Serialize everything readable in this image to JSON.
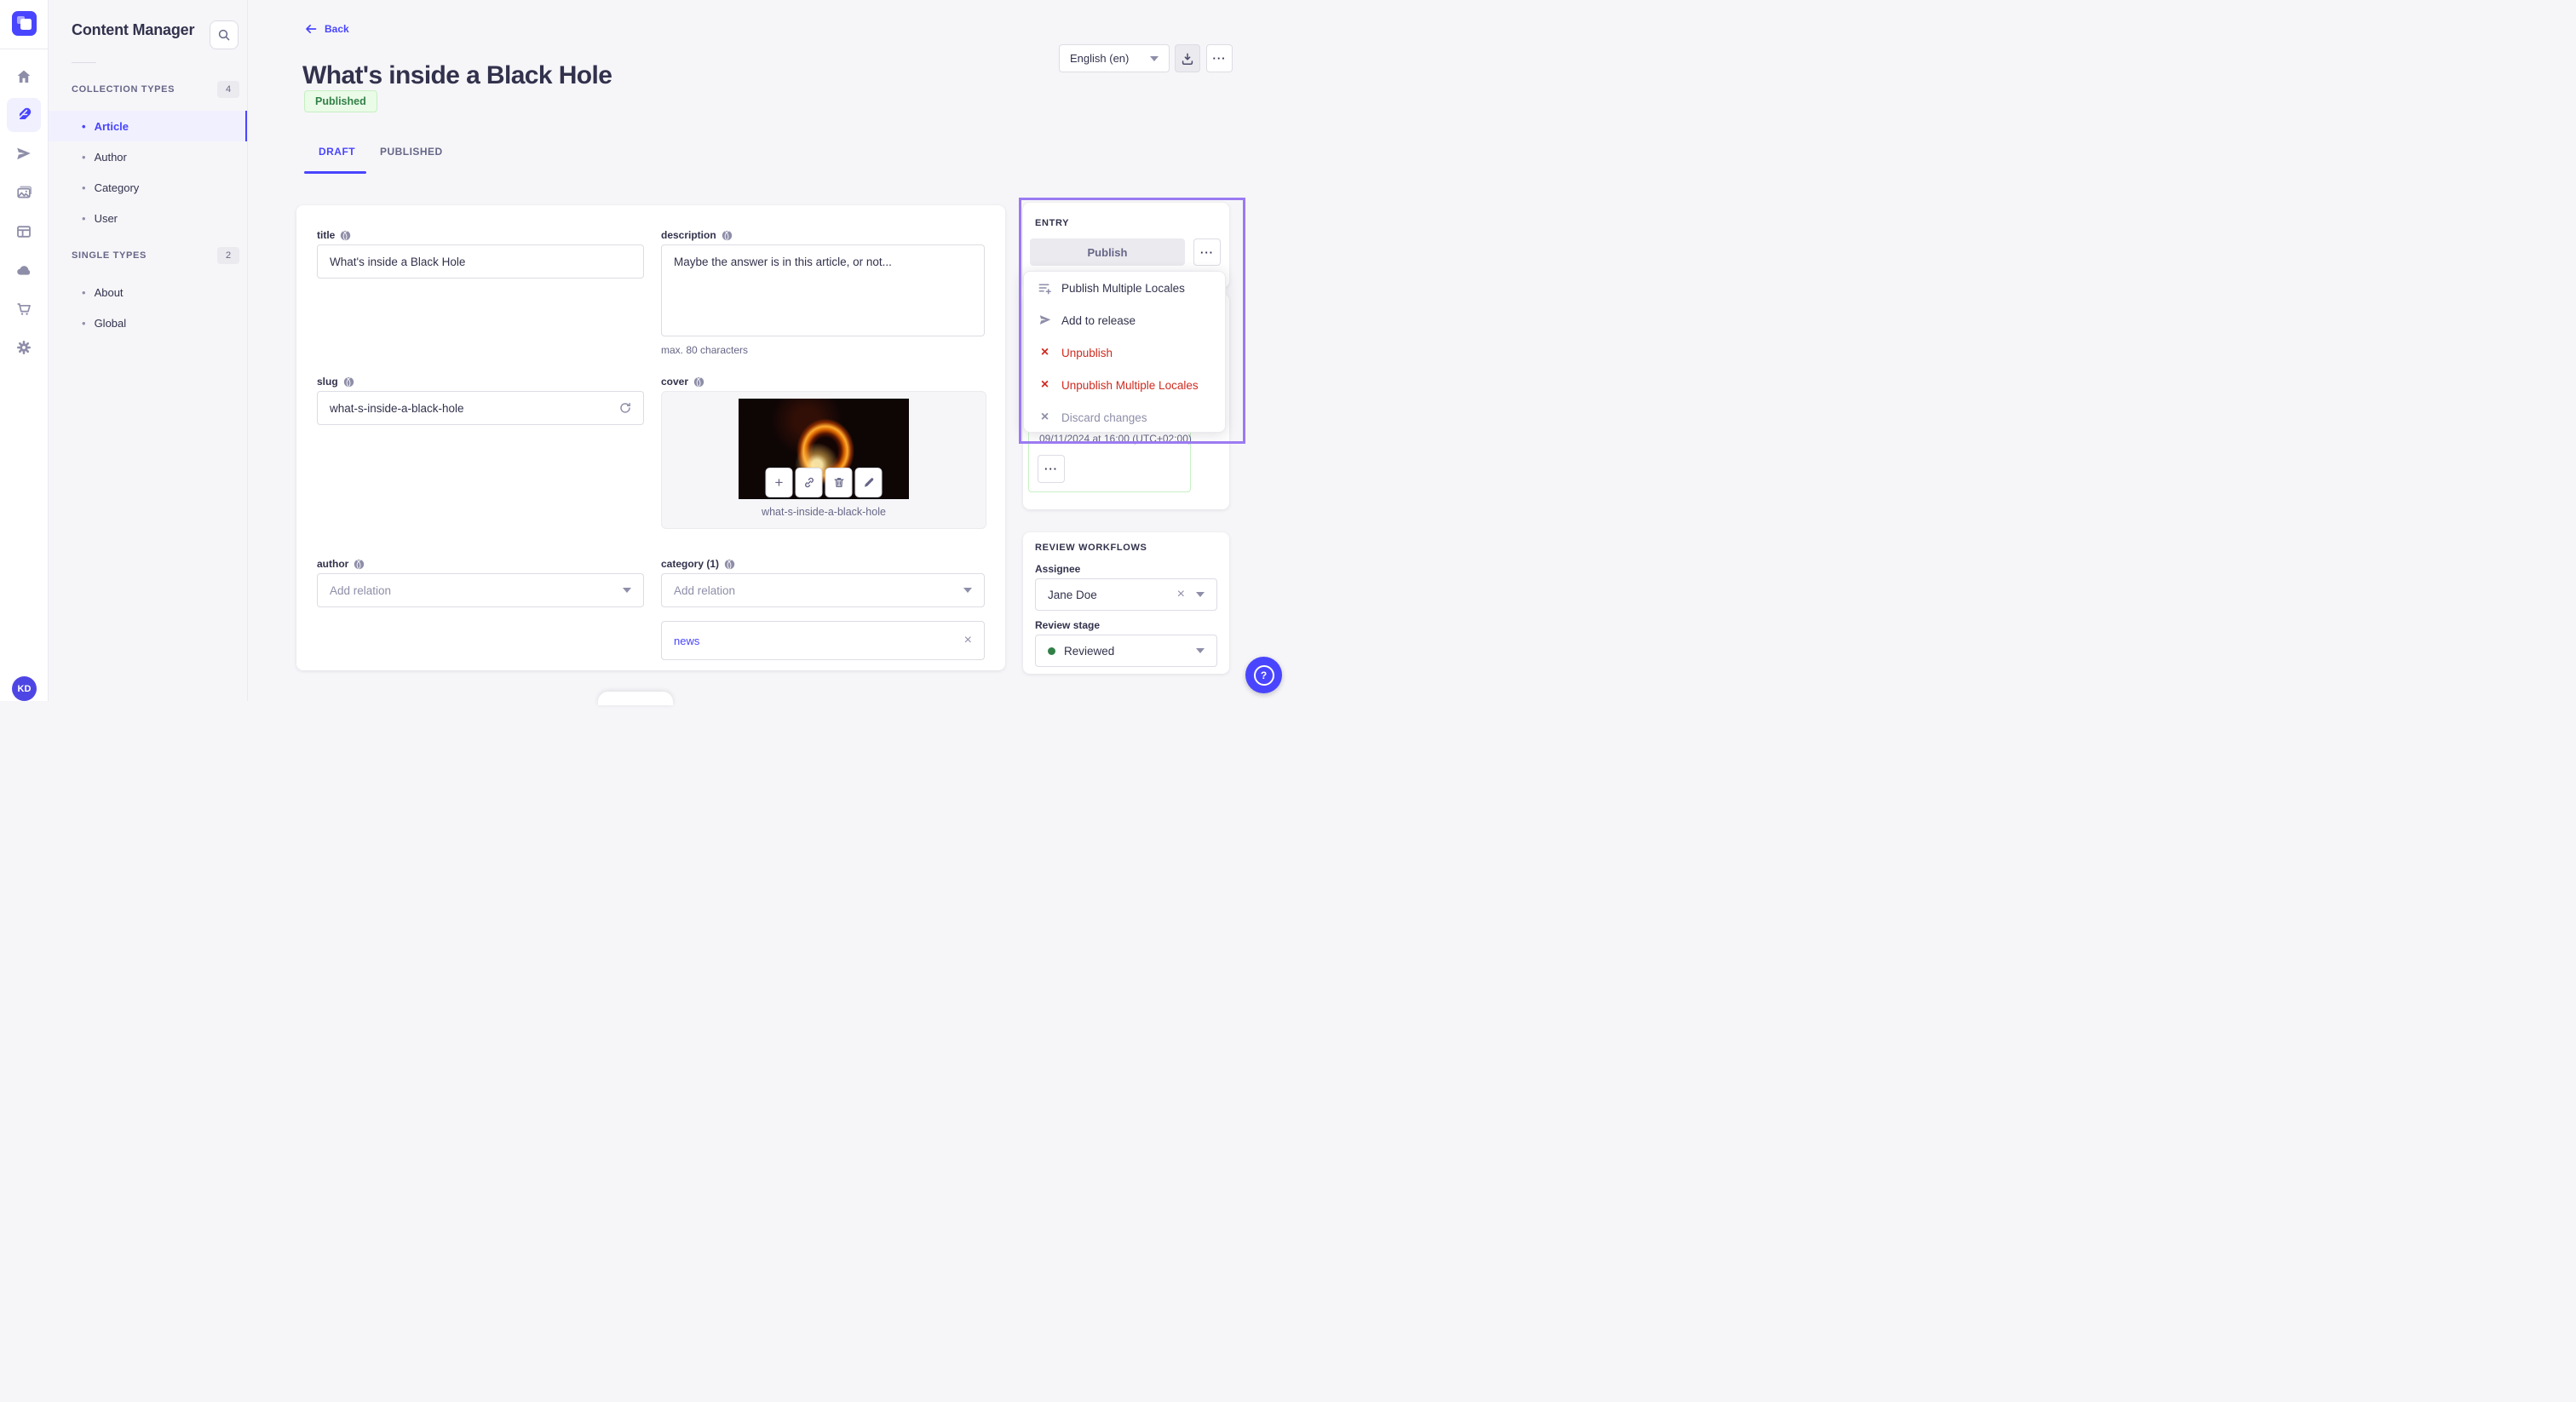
{
  "sidebar": {
    "avatar_initials": "KD",
    "icons": [
      "home",
      "content-manager",
      "releases",
      "media-library",
      "content-type-builder",
      "cloud",
      "marketplace",
      "settings"
    ]
  },
  "subnav": {
    "title": "Content Manager",
    "sections": [
      {
        "label": "COLLECTION TYPES",
        "count": "4",
        "items": [
          {
            "label": "Article"
          },
          {
            "label": "Author"
          },
          {
            "label": "Category"
          },
          {
            "label": "User"
          }
        ]
      },
      {
        "label": "SINGLE TYPES",
        "count": "2",
        "items": [
          {
            "label": "About"
          },
          {
            "label": "Global"
          }
        ]
      }
    ]
  },
  "header": {
    "back_label": "Back",
    "title": "What's inside a Black Hole",
    "status": "Published",
    "tabs": {
      "draft": "DRAFT",
      "published": "PUBLISHED"
    },
    "locale": "English (en)"
  },
  "form": {
    "title": {
      "label": "title",
      "value": "What's inside a Black Hole"
    },
    "description": {
      "label": "description",
      "value": "Maybe the answer is in this article, or not...",
      "hint": "max. 80 characters"
    },
    "slug": {
      "label": "slug",
      "value": "what-s-inside-a-black-hole"
    },
    "cover": {
      "label": "cover",
      "filename": "what-s-inside-a-black-hole"
    },
    "author": {
      "label": "author",
      "placeholder": "Add relation"
    },
    "category": {
      "label": "category (1)",
      "placeholder": "Add relation",
      "tag": "news"
    }
  },
  "entry_panel": {
    "heading": "ENTRY",
    "publish_label": "Publish",
    "menu": [
      {
        "label": "Publish Multiple Locales",
        "type": "default"
      },
      {
        "label": "Add to release",
        "type": "default"
      },
      {
        "label": "Unpublish",
        "type": "danger"
      },
      {
        "label": "Unpublish Multiple Locales",
        "type": "danger"
      },
      {
        "label": "Discard changes",
        "type": "disabled"
      }
    ],
    "scheduled": "09/11/2024 at 16:00 (UTC+02:00)"
  },
  "review": {
    "heading": "REVIEW WORKFLOWS",
    "assignee_label": "Assignee",
    "assignee": "Jane Doe",
    "stage_label": "Review stage",
    "stage": "Reviewed"
  },
  "icons": {
    "bullet": "•",
    "more": "···",
    "close": "×",
    "plus": "+",
    "question": "?"
  },
  "colors": {
    "accent": "#4945FF",
    "danger": "#D02B20",
    "success": "#328048",
    "success_bg": "#EAFBE7",
    "highlight": "#9B7AF2"
  }
}
